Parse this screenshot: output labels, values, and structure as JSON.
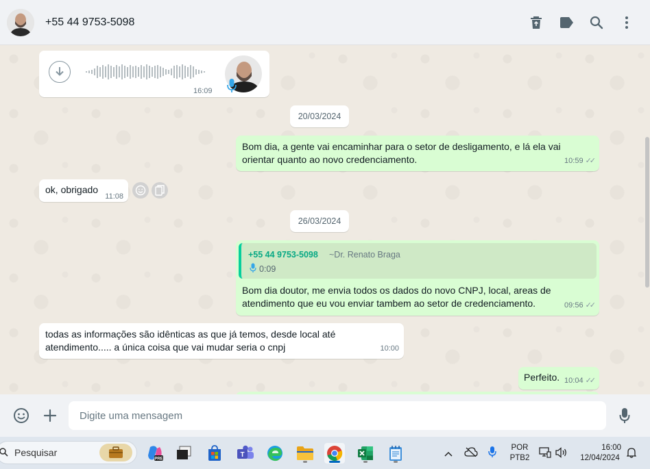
{
  "header": {
    "contact_name": "+55 44 9753-5098",
    "icons": [
      "delete-icon",
      "label-icon",
      "search-icon",
      "menu-icon"
    ]
  },
  "messages": {
    "voice": {
      "time": "16:09"
    },
    "date1": "20/03/2024",
    "m1": {
      "text": "Bom dia, a gente vai encaminhar para o setor de desligamento, e lá ela vai orientar quanto ao novo credenciamento.",
      "time": "10:59"
    },
    "m2": {
      "text": "ok, obrigado",
      "time": "11:08"
    },
    "date2": "26/03/2024",
    "m3": {
      "quote_sender": "+55 44 9753-5098",
      "quote_alias": "~Dr. Renato Braga",
      "quote_duration": "0:09",
      "text": "Bom dia doutor, me envia todos os dados do novo CNPJ, local, areas de atendimento que eu vou enviar tambem ao setor de credenciamento.",
      "time": "09:56"
    },
    "m4": {
      "text": "todas as informações são idênticas as que já temos, desde local até atendimento..... a única coisa que vai mudar seria o cnpj",
      "time": "10:00"
    },
    "m5": {
      "text": "Perfeito.",
      "time": "10:04"
    }
  },
  "composer": {
    "placeholder": "Digite uma mensagem"
  },
  "taskbar": {
    "search_label": "Pesquisar",
    "lang_line1": "POR",
    "lang_line2": "PTB2",
    "clock_time": "16:00",
    "clock_date": "12/04/2024"
  },
  "colors": {
    "outgoing": "#d9fdd3",
    "incoming": "#ffffff",
    "accent": "#06cf9c",
    "header": "#f0f2f5"
  }
}
